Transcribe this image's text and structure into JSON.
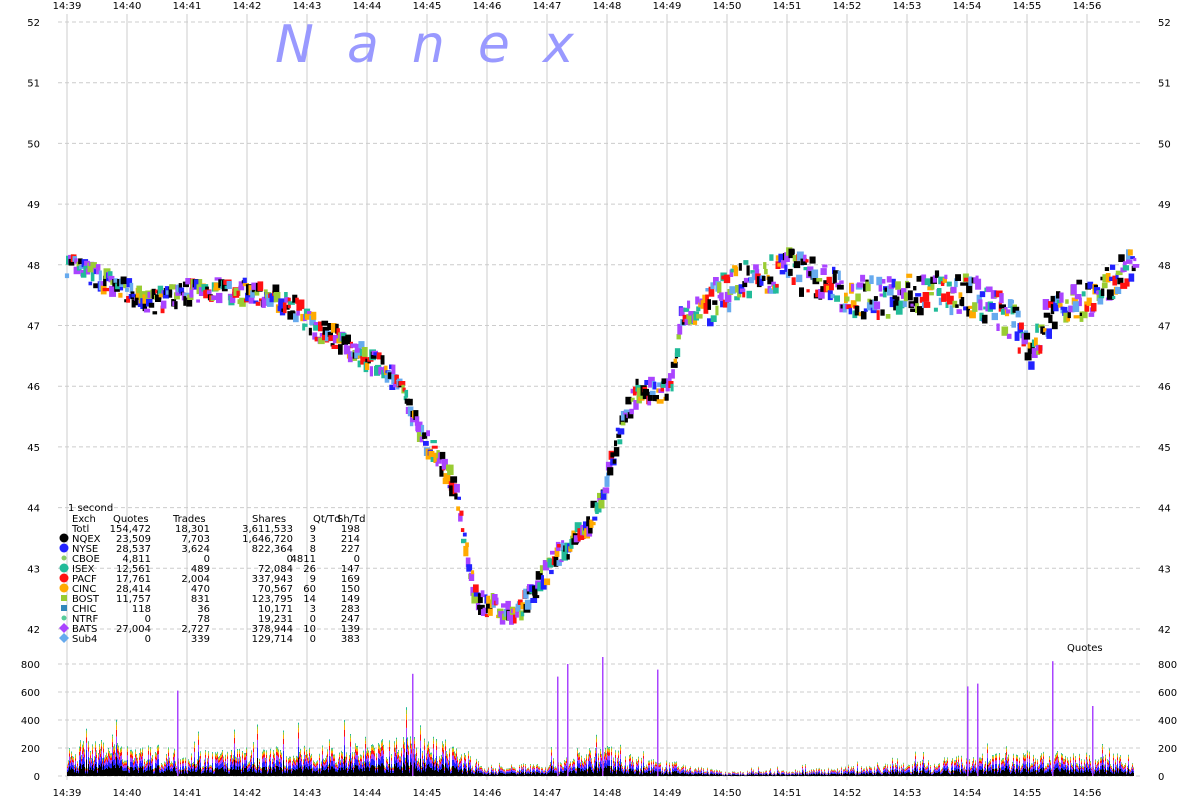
{
  "chart_data": [
    {
      "type": "scatter",
      "description_only_of_shape": null,
      "watermark": "N  a  n  e  x",
      "x_ticks": [
        "14:39",
        "14:40",
        "14:41",
        "14:42",
        "14:43",
        "14:44",
        "14:45",
        "14:46",
        "14:47",
        "14:48",
        "14:49",
        "14:50",
        "14:51",
        "14:52",
        "14:53",
        "14:54",
        "14:55",
        "14:56"
      ],
      "y_ticks": [
        "52",
        "51",
        "50",
        "49",
        "48",
        "47",
        "46",
        "45",
        "44",
        "43",
        "42"
      ],
      "ylim": [
        41.6,
        52
      ],
      "grid": true,
      "price_path": [
        {
          "x": "14:39:00",
          "y": 48.0
        },
        {
          "x": "14:39:30",
          "y": 47.8
        },
        {
          "x": "14:40:00",
          "y": 47.55
        },
        {
          "x": "14:40:20",
          "y": 47.35
        },
        {
          "x": "14:40:40",
          "y": 47.45
        },
        {
          "x": "14:41:00",
          "y": 47.55
        },
        {
          "x": "14:41:30",
          "y": 47.6
        },
        {
          "x": "14:42:00",
          "y": 47.55
        },
        {
          "x": "14:42:30",
          "y": 47.45
        },
        {
          "x": "14:42:50",
          "y": 47.25
        },
        {
          "x": "14:43:10",
          "y": 46.95
        },
        {
          "x": "14:43:40",
          "y": 46.7
        },
        {
          "x": "14:44:00",
          "y": 46.45
        },
        {
          "x": "14:44:20",
          "y": 46.25
        },
        {
          "x": "14:44:35",
          "y": 45.9
        },
        {
          "x": "14:44:50",
          "y": 45.35
        },
        {
          "x": "14:45:10",
          "y": 44.85
        },
        {
          "x": "14:45:30",
          "y": 44.25
        },
        {
          "x": "14:45:40",
          "y": 43.3
        },
        {
          "x": "14:45:50",
          "y": 42.45
        },
        {
          "x": "14:46:10",
          "y": 42.3
        },
        {
          "x": "14:46:30",
          "y": 42.25
        },
        {
          "x": "14:46:50",
          "y": 42.7
        },
        {
          "x": "14:47:10",
          "y": 43.2
        },
        {
          "x": "14:47:40",
          "y": 43.65
        },
        {
          "x": "14:48:00",
          "y": 44.4
        },
        {
          "x": "14:48:15",
          "y": 45.4
        },
        {
          "x": "14:48:30",
          "y": 45.9
        },
        {
          "x": "14:48:50",
          "y": 45.9
        },
        {
          "x": "14:49:05",
          "y": 46.0
        },
        {
          "x": "14:49:15",
          "y": 47.2
        },
        {
          "x": "14:49:40",
          "y": 47.3
        },
        {
          "x": "14:50:00",
          "y": 47.6
        },
        {
          "x": "14:50:30",
          "y": 47.8
        },
        {
          "x": "14:51:00",
          "y": 47.95
        },
        {
          "x": "14:51:30",
          "y": 47.75
        },
        {
          "x": "14:52:00",
          "y": 47.5
        },
        {
          "x": "14:52:30",
          "y": 47.45
        },
        {
          "x": "14:53:00",
          "y": 47.5
        },
        {
          "x": "14:53:30",
          "y": 47.55
        },
        {
          "x": "14:54:00",
          "y": 47.5
        },
        {
          "x": "14:54:30",
          "y": 47.3
        },
        {
          "x": "14:54:50",
          "y": 47.0
        },
        {
          "x": "14:55:00",
          "y": 46.55
        },
        {
          "x": "14:55:10",
          "y": 46.7
        },
        {
          "x": "14:55:20",
          "y": 47.1
        },
        {
          "x": "14:55:40",
          "y": 47.35
        },
        {
          "x": "14:56:00",
          "y": 47.45
        },
        {
          "x": "14:56:20",
          "y": 47.65
        },
        {
          "x": "14:56:40",
          "y": 47.9
        },
        {
          "x": "14:56:50",
          "y": 48.05
        }
      ],
      "legend_table": {
        "interval": "1 second",
        "headers": [
          "Exch",
          "Quotes",
          "Trades",
          "Shares",
          "Qt/Td",
          "Sh/Td"
        ],
        "rows": [
          {
            "exch": "Totl",
            "quotes": "154,472",
            "trades": "18,301",
            "shares": "3,611,533",
            "qt_td": "9",
            "sh_td": "198",
            "color": "",
            "marker": "none"
          },
          {
            "exch": "NQEX",
            "quotes": "23,509",
            "trades": "7,703",
            "shares": "1,646,720",
            "qt_td": "3",
            "sh_td": "214",
            "color": "#000000",
            "marker": "circle"
          },
          {
            "exch": "NYSE",
            "quotes": "28,537",
            "trades": "3,624",
            "shares": "822,364",
            "qt_td": "8",
            "sh_td": "227",
            "color": "#2222ff",
            "marker": "circle"
          },
          {
            "exch": "CBOE",
            "quotes": "4,811",
            "trades": "0",
            "shares": "0",
            "qt_td": "4811",
            "sh_td": "0",
            "color": "#88cc66",
            "marker": "small-circle"
          },
          {
            "exch": "ISEX",
            "quotes": "12,561",
            "trades": "489",
            "shares": "72,084",
            "qt_td": "26",
            "sh_td": "147",
            "color": "#22bb99",
            "marker": "circle"
          },
          {
            "exch": "PACF",
            "quotes": "17,761",
            "trades": "2,004",
            "shares": "337,943",
            "qt_td": "9",
            "sh_td": "169",
            "color": "#ff1111",
            "marker": "circle"
          },
          {
            "exch": "CINC",
            "quotes": "28,414",
            "trades": "470",
            "shares": "70,567",
            "qt_td": "60",
            "sh_td": "150",
            "color": "#ffaa00",
            "marker": "circle"
          },
          {
            "exch": "BOST",
            "quotes": "11,757",
            "trades": "831",
            "shares": "123,795",
            "qt_td": "14",
            "sh_td": "149",
            "color": "#99cc33",
            "marker": "square"
          },
          {
            "exch": "CHIC",
            "quotes": "118",
            "trades": "36",
            "shares": "10,171",
            "qt_td": "3",
            "sh_td": "283",
            "color": "#3388bb",
            "marker": "square"
          },
          {
            "exch": "NTRF",
            "quotes": "0",
            "trades": "78",
            "shares": "19,231",
            "qt_td": "0",
            "sh_td": "247",
            "color": "#55cc99",
            "marker": "small-circle"
          },
          {
            "exch": "BATS",
            "quotes": "27,004",
            "trades": "2,727",
            "shares": "378,944",
            "qt_td": "10",
            "sh_td": "139",
            "color": "#aa44ff",
            "marker": "diamond"
          },
          {
            "exch": "Sub4",
            "quotes": "0",
            "trades": "339",
            "shares": "129,714",
            "qt_td": "0",
            "sh_td": "383",
            "color": "#66aaee",
            "marker": "diamond"
          }
        ]
      }
    },
    {
      "type": "bar",
      "label": "Quotes",
      "y_ticks": [
        "800",
        "600",
        "400",
        "200",
        "0"
      ],
      "ylim": [
        0,
        800
      ],
      "x_ticks": [
        "14:39",
        "14:40",
        "14:41",
        "14:42",
        "14:43",
        "14:44",
        "14:45",
        "14:46",
        "14:47",
        "14:48",
        "14:49",
        "14:50",
        "14:51",
        "14:52",
        "14:53",
        "14:54",
        "14:55",
        "14:56"
      ],
      "activity_profile": [
        {
          "x": "14:39:00",
          "level": 230
        },
        {
          "x": "14:40:00",
          "level": 220
        },
        {
          "x": "14:41:00",
          "level": 170
        },
        {
          "x": "14:42:00",
          "level": 180
        },
        {
          "x": "14:43:00",
          "level": 190
        },
        {
          "x": "14:44:00",
          "level": 220
        },
        {
          "x": "14:45:00",
          "level": 260
        },
        {
          "x": "14:45:40",
          "level": 150
        },
        {
          "x": "14:46:00",
          "level": 60
        },
        {
          "x": "14:47:00",
          "level": 100
        },
        {
          "x": "14:47:40",
          "level": 170
        },
        {
          "x": "14:48:00",
          "level": 200
        },
        {
          "x": "14:48:40",
          "level": 110
        },
        {
          "x": "14:49:10",
          "level": 90
        },
        {
          "x": "14:50:00",
          "level": 30
        },
        {
          "x": "14:51:00",
          "level": 40
        },
        {
          "x": "14:52:00",
          "level": 60
        },
        {
          "x": "14:53:00",
          "level": 90
        },
        {
          "x": "14:54:00",
          "level": 140
        },
        {
          "x": "14:55:00",
          "level": 160
        },
        {
          "x": "14:56:00",
          "level": 150
        },
        {
          "x": "14:56:50",
          "level": 130
        }
      ],
      "spikes": [
        {
          "x": "14:40:50",
          "value": 610
        },
        {
          "x": "14:44:45",
          "value": 730
        },
        {
          "x": "14:47:10",
          "value": 710
        },
        {
          "x": "14:47:20",
          "value": 800
        },
        {
          "x": "14:47:55",
          "value": 850
        },
        {
          "x": "14:48:50",
          "value": 760
        },
        {
          "x": "14:54:00",
          "value": 640
        },
        {
          "x": "14:54:10",
          "value": 660
        },
        {
          "x": "14:55:25",
          "value": 820
        },
        {
          "x": "14:56:05",
          "value": 500
        }
      ],
      "series_colors": [
        "#000000",
        "#2222ff",
        "#aa44ff",
        "#ff1111",
        "#ffaa00",
        "#99cc33",
        "#22bb99"
      ]
    }
  ]
}
